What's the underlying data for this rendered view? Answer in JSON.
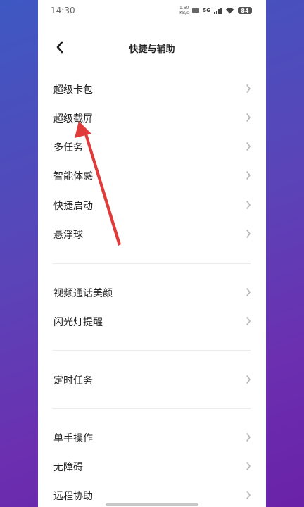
{
  "status_bar": {
    "time": "14:30",
    "net_speed_value": "1.60",
    "net_speed_unit": "KB/s",
    "network": "5G",
    "battery": "84"
  },
  "header": {
    "title": "快捷与辅助",
    "back_icon": "chevron-left-icon"
  },
  "groups": [
    {
      "items": [
        {
          "label": "超级卡包"
        },
        {
          "label": "超级截屏"
        },
        {
          "label": "多任务"
        },
        {
          "label": "智能体感"
        },
        {
          "label": "快捷启动"
        },
        {
          "label": "悬浮球"
        }
      ]
    },
    {
      "items": [
        {
          "label": "视频通话美颜"
        },
        {
          "label": "闪光灯提醒"
        }
      ]
    },
    {
      "items": [
        {
          "label": "定时任务"
        }
      ]
    },
    {
      "items": [
        {
          "label": "单手操作"
        },
        {
          "label": "无障碍"
        },
        {
          "label": "远程协助"
        }
      ]
    }
  ],
  "annotation": {
    "arrow_color": "#e03a3a",
    "points_to": "超级截屏"
  },
  "colors": {
    "background_gradient_start": "#3e58c2",
    "background_gradient_end": "#6a22a8",
    "panel": "#ffffff",
    "text": "#222222",
    "chevron": "#b5b5b5"
  }
}
